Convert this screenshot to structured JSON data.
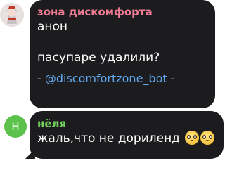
{
  "messages": [
    {
      "sender": "зона дискомфорта",
      "lines": [
        "анон",
        "",
        "пасупаре удалили?"
      ],
      "footer_prefix": "- ",
      "footer_link": "@discomfortzone_bot",
      "footer_suffix": " -",
      "sender_color": "#ef7b94"
    },
    {
      "sender": "нёля",
      "avatar_letter": "Н",
      "text": "жаль,что не дориленд",
      "emojis": [
        "pleading-face-emoji",
        "pleading-face-emoji"
      ],
      "sender_color": "#74d05c",
      "avatar_color": "#5cc24c"
    }
  ],
  "colors": {
    "bubble": "#1c1c1e",
    "link": "#5fa8ef",
    "background": "#ffffff"
  }
}
